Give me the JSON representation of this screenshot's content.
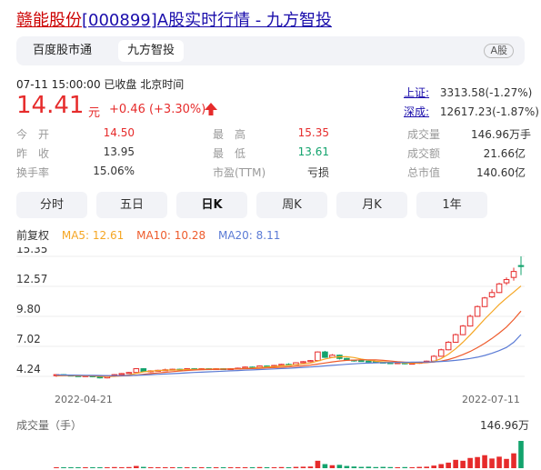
{
  "title": {
    "highlight": "赣能股份",
    "code": "[000899]",
    "rest": "A股实时行情 - 九方智投"
  },
  "tabs": [
    "百度股市通",
    "九方智投"
  ],
  "badge": "A股",
  "status_time": "07-11 15:00:00  已收盘  北京时间",
  "price": "14.41",
  "unit": "元",
  "change": "+0.46 (+3.30%)",
  "indices": [
    {
      "label": "上证:",
      "value": "3313.58(-1.27%)"
    },
    {
      "label": "深成:",
      "value": "12617.23(-1.87%)"
    }
  ],
  "stats": [
    {
      "label": "今　开",
      "value": "14.50",
      "color": "red"
    },
    {
      "label": "最　高",
      "value": "15.35",
      "color": "red"
    },
    {
      "label": "成交量",
      "value": "146.96万手",
      "color": ""
    },
    {
      "label": "昨　收",
      "value": "13.95",
      "color": ""
    },
    {
      "label": "最　低",
      "value": "13.61",
      "color": "green"
    },
    {
      "label": "成交额",
      "value": "21.66亿",
      "color": ""
    },
    {
      "label": "换手率",
      "value": "15.06%",
      "color": ""
    },
    {
      "label": "市盈(TTM)",
      "value": "亏损",
      "color": ""
    },
    {
      "label": "总市值",
      "value": "140.60亿",
      "color": ""
    }
  ],
  "period_buttons": [
    "分时",
    "五日",
    "日K",
    "周K",
    "月K",
    "1年"
  ],
  "active_period": "日K",
  "ma_legend": {
    "adj": "前复权",
    "ma5": "MA5: 12.61",
    "ma10": "MA10: 10.28",
    "ma20": "MA20: 8.11"
  },
  "colors": {
    "up": "#e62b2b",
    "down": "#13a36d",
    "ma5": "#f5a623",
    "ma10": "#ee5b2c",
    "ma20": "#5b7bd5"
  },
  "volume_header": "成交量（手）",
  "volume_max": "146.96万",
  "chart_data": {
    "type": "candlestick",
    "x_labels": [
      "2022-04-21",
      "2022-07-11"
    ],
    "y_ticks": [
      "15.35",
      "12.57",
      "9.80",
      "7.02",
      "4.24"
    ],
    "ylim": [
      4.24,
      15.35
    ],
    "candles": [
      [
        4.3,
        4.4,
        4.2,
        4.45
      ],
      [
        4.4,
        4.35,
        4.3,
        4.45
      ],
      [
        4.35,
        4.3,
        4.25,
        4.4
      ],
      [
        4.3,
        4.25,
        4.2,
        4.35
      ],
      [
        4.25,
        4.3,
        4.2,
        4.35
      ],
      [
        4.3,
        4.2,
        4.15,
        4.35
      ],
      [
        4.2,
        4.1,
        4.05,
        4.25
      ],
      [
        4.1,
        4.3,
        4.05,
        4.35
      ],
      [
        4.3,
        4.4,
        4.25,
        4.45
      ],
      [
        4.4,
        4.5,
        4.35,
        4.55
      ],
      [
        4.5,
        4.6,
        4.45,
        4.65
      ],
      [
        4.6,
        4.95,
        4.55,
        5.0
      ],
      [
        4.95,
        4.7,
        4.65,
        5.0
      ],
      [
        4.7,
        4.75,
        4.6,
        4.8
      ],
      [
        4.75,
        4.8,
        4.7,
        4.85
      ],
      [
        4.8,
        4.85,
        4.75,
        4.95
      ],
      [
        4.85,
        4.9,
        4.8,
        4.95
      ],
      [
        4.9,
        4.85,
        4.8,
        4.95
      ],
      [
        4.85,
        4.95,
        4.8,
        5.0
      ],
      [
        4.95,
        4.9,
        4.85,
        5.0
      ],
      [
        4.9,
        4.95,
        4.85,
        5.0
      ],
      [
        4.95,
        4.9,
        4.85,
        5.0
      ],
      [
        4.9,
        4.95,
        4.85,
        5.0
      ],
      [
        4.95,
        4.9,
        4.85,
        5.0
      ],
      [
        4.9,
        4.95,
        4.85,
        5.0
      ],
      [
        4.95,
        5.0,
        4.9,
        5.05
      ],
      [
        5.0,
        5.1,
        4.95,
        5.15
      ],
      [
        5.1,
        5.05,
        5.0,
        5.15
      ],
      [
        5.05,
        5.2,
        5.0,
        5.25
      ],
      [
        5.2,
        5.15,
        5.1,
        5.25
      ],
      [
        5.15,
        5.25,
        5.1,
        5.3
      ],
      [
        5.25,
        5.35,
        5.2,
        5.4
      ],
      [
        5.35,
        5.3,
        5.25,
        5.45
      ],
      [
        5.3,
        5.5,
        5.25,
        5.55
      ],
      [
        5.5,
        5.6,
        5.45,
        5.65
      ],
      [
        5.6,
        5.7,
        5.55,
        5.75
      ],
      [
        5.7,
        6.5,
        5.65,
        6.55
      ],
      [
        6.5,
        6.0,
        5.95,
        6.6
      ],
      [
        6.0,
        6.2,
        5.95,
        6.3
      ],
      [
        6.2,
        5.9,
        5.8,
        6.25
      ],
      [
        5.9,
        5.75,
        5.7,
        5.95
      ],
      [
        5.75,
        5.7,
        5.6,
        5.8
      ],
      [
        5.7,
        5.65,
        5.6,
        5.75
      ],
      [
        5.65,
        5.6,
        5.55,
        5.7
      ],
      [
        5.6,
        5.55,
        5.5,
        5.65
      ],
      [
        5.55,
        5.5,
        5.45,
        5.6
      ],
      [
        5.5,
        5.45,
        5.4,
        5.55
      ],
      [
        5.45,
        5.5,
        5.4,
        5.55
      ],
      [
        5.5,
        5.4,
        5.35,
        5.55
      ],
      [
        5.4,
        5.45,
        5.35,
        5.5
      ],
      [
        5.45,
        5.55,
        5.4,
        5.6
      ],
      [
        5.55,
        5.65,
        5.5,
        5.7
      ],
      [
        5.65,
        6.1,
        5.6,
        6.2
      ],
      [
        6.1,
        6.7,
        6.05,
        6.8
      ],
      [
        6.7,
        7.4,
        6.65,
        7.5
      ],
      [
        7.4,
        8.1,
        7.35,
        8.2
      ],
      [
        8.1,
        8.9,
        8.05,
        9.0
      ],
      [
        8.9,
        9.8,
        8.85,
        9.95
      ],
      [
        9.8,
        10.7,
        9.75,
        10.8
      ],
      [
        10.7,
        11.5,
        10.65,
        11.6
      ],
      [
        11.6,
        12.0,
        11.5,
        12.3
      ],
      [
        12.0,
        12.8,
        11.95,
        12.9
      ],
      [
        12.9,
        13.2,
        12.7,
        13.4
      ],
      [
        13.4,
        13.95,
        13.1,
        14.3
      ],
      [
        14.5,
        14.41,
        13.61,
        15.35
      ]
    ],
    "ma5": [
      4.3,
      4.31,
      4.31,
      4.3,
      4.3,
      4.28,
      4.24,
      4.23,
      4.24,
      4.29,
      4.36,
      4.52,
      4.66,
      4.72,
      4.78,
      4.81,
      4.83,
      4.85,
      4.87,
      4.89,
      4.9,
      4.91,
      4.91,
      4.92,
      4.92,
      4.94,
      4.97,
      5.01,
      5.06,
      5.11,
      5.15,
      5.21,
      5.26,
      5.32,
      5.4,
      5.48,
      5.65,
      5.85,
      5.98,
      6.06,
      6.06,
      5.98,
      5.84,
      5.74,
      5.64,
      5.59,
      5.54,
      5.51,
      5.48,
      5.46,
      5.47,
      5.51,
      5.63,
      5.89,
      6.29,
      6.79,
      7.4,
      8.08,
      8.8,
      9.54,
      10.22,
      10.9,
      11.49,
      12.04,
      12.61
    ],
    "ma10": [
      4.32,
      4.33,
      4.33,
      4.32,
      4.31,
      4.3,
      4.28,
      4.27,
      4.27,
      4.28,
      4.3,
      4.36,
      4.43,
      4.5,
      4.56,
      4.62,
      4.68,
      4.74,
      4.79,
      4.83,
      4.86,
      4.88,
      4.89,
      4.9,
      4.91,
      4.92,
      4.94,
      4.96,
      4.99,
      5.02,
      5.05,
      5.08,
      5.12,
      5.17,
      5.22,
      5.28,
      5.38,
      5.48,
      5.58,
      5.66,
      5.72,
      5.75,
      5.77,
      5.77,
      5.76,
      5.72,
      5.66,
      5.6,
      5.56,
      5.53,
      5.51,
      5.52,
      5.56,
      5.65,
      5.8,
      6.0,
      6.25,
      6.55,
      6.9,
      7.3,
      7.75,
      8.25,
      8.8,
      9.5,
      10.28
    ],
    "ma20": [
      4.38,
      4.37,
      4.36,
      4.35,
      4.34,
      4.33,
      4.32,
      4.31,
      4.31,
      4.31,
      4.32,
      4.34,
      4.37,
      4.4,
      4.43,
      4.46,
      4.49,
      4.53,
      4.57,
      4.6,
      4.63,
      4.66,
      4.69,
      4.72,
      4.75,
      4.78,
      4.81,
      4.84,
      4.87,
      4.9,
      4.93,
      4.96,
      4.99,
      5.03,
      5.07,
      5.11,
      5.16,
      5.21,
      5.26,
      5.31,
      5.36,
      5.4,
      5.44,
      5.47,
      5.49,
      5.51,
      5.52,
      5.53,
      5.54,
      5.55,
      5.56,
      5.57,
      5.59,
      5.62,
      5.66,
      5.72,
      5.8,
      5.9,
      6.02,
      6.18,
      6.38,
      6.62,
      6.92,
      7.4,
      8.11
    ],
    "volume": [
      4,
      3,
      3,
      2,
      3,
      4,
      3,
      5,
      6,
      5,
      6,
      12,
      7,
      5,
      4,
      5,
      4,
      3,
      4,
      3,
      4,
      3,
      3,
      4,
      3,
      4,
      5,
      4,
      6,
      5,
      5,
      6,
      5,
      7,
      8,
      9,
      40,
      22,
      16,
      18,
      12,
      9,
      7,
      8,
      6,
      7,
      6,
      5,
      6,
      5,
      7,
      8,
      14,
      22,
      30,
      45,
      40,
      55,
      60,
      70,
      52,
      62,
      50,
      80,
      146.96
    ]
  }
}
